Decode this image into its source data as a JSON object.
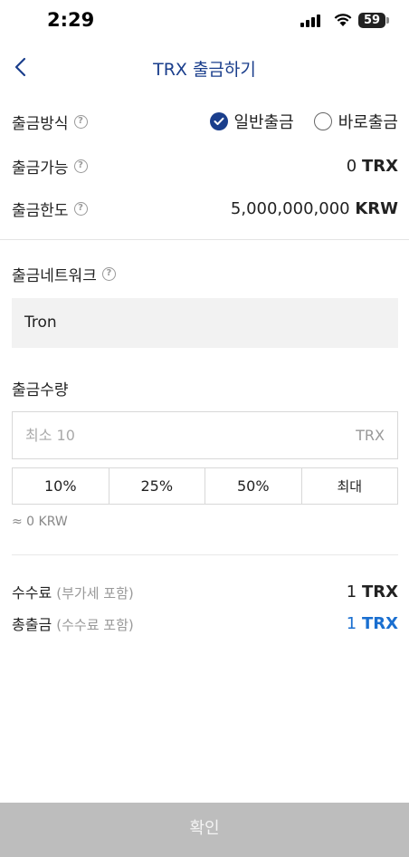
{
  "status": {
    "time": "2:29",
    "battery": "59"
  },
  "nav": {
    "title": "TRX 출금하기"
  },
  "method": {
    "label": "출금방식",
    "option_general": "일반출금",
    "option_instant": "바로출금"
  },
  "available": {
    "label": "출금가능",
    "amount": "0",
    "unit": "TRX"
  },
  "limit": {
    "label": "출금한도",
    "amount": "5,000,000,000",
    "unit": "KRW"
  },
  "network": {
    "label": "출금네트워크",
    "value": "Tron"
  },
  "amount": {
    "label": "출금수량",
    "placeholder": "최소 10",
    "unit": "TRX",
    "quick": [
      "10%",
      "25%",
      "50%",
      "최대"
    ],
    "krw_estimate": "≈ 0 KRW"
  },
  "fee": {
    "label": "수수료",
    "sub": "(부가세 포함)",
    "amount": "1",
    "unit": "TRX"
  },
  "total": {
    "label": "총출금",
    "sub": "(수수료 포함)",
    "amount": "1",
    "unit": "TRX"
  },
  "confirm": {
    "label": "확인"
  },
  "colors": {
    "brand": "#1a3e8c",
    "total": "#1a6fd0",
    "confirm_disabled": "#bdbdbd"
  },
  "icons": {
    "back": "chevron-left-icon",
    "help": "question-circle-icon",
    "checked": "check-circle-icon"
  }
}
